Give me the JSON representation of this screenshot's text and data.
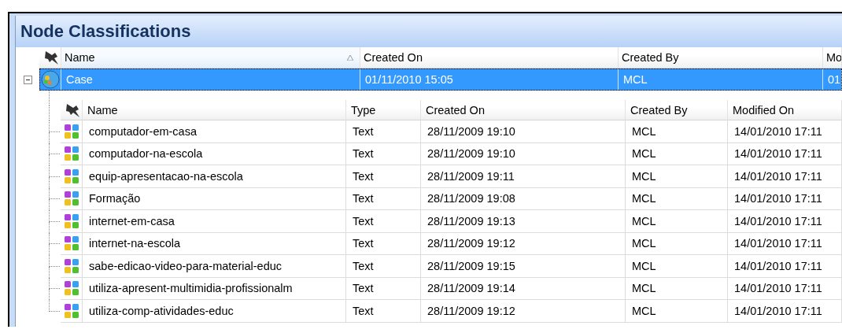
{
  "window": {
    "title": "Node Classifications"
  },
  "parent_table": {
    "columns": [
      {
        "label": "Name",
        "sorted": true
      },
      {
        "label": "Created On",
        "sorted": false
      },
      {
        "label": "Created By",
        "sorted": false
      },
      {
        "label": "Mo",
        "sorted": false
      }
    ],
    "rows": [
      {
        "cells": [
          "Case",
          "01/11/2010 15:05",
          "MCL",
          "01"
        ],
        "selected": true,
        "expanded": true,
        "child_table": {
          "columns": [
            "Name",
            "Type",
            "Created On",
            "Created By",
            "Modified On"
          ],
          "rows": [
            [
              "computador-em-casa",
              "Text",
              "28/11/2009 19:10",
              "MCL",
              "14/01/2010 17:11"
            ],
            [
              "computador-na-escola",
              "Text",
              "28/11/2009 19:10",
              "MCL",
              "14/01/2010 17:11"
            ],
            [
              "equip-apresentacao-na-escola",
              "Text",
              "28/11/2009 19:11",
              "MCL",
              "14/01/2010 17:11"
            ],
            [
              "Formação",
              "Text",
              "28/11/2009 19:08",
              "MCL",
              "14/01/2010 17:11"
            ],
            [
              "internet-em-casa",
              "Text",
              "28/11/2009 19:13",
              "MCL",
              "14/01/2010 17:11"
            ],
            [
              "internet-na-escola",
              "Text",
              "28/11/2009 19:12",
              "MCL",
              "14/01/2010 17:11"
            ],
            [
              "sabe-edicao-video-para-material-educ",
              "Text",
              "28/11/2009 19:15",
              "MCL",
              "14/01/2010 17:11"
            ],
            [
              "utiliza-apresent-multimidia-profissionalm",
              "Text",
              "28/11/2009 19:14",
              "MCL",
              "14/01/2010 17:11"
            ],
            [
              "utiliza-comp-atividades-educ",
              "Text",
              "28/11/2009 19:12",
              "MCL",
              "14/01/2010 17:11"
            ]
          ]
        }
      }
    ]
  }
}
